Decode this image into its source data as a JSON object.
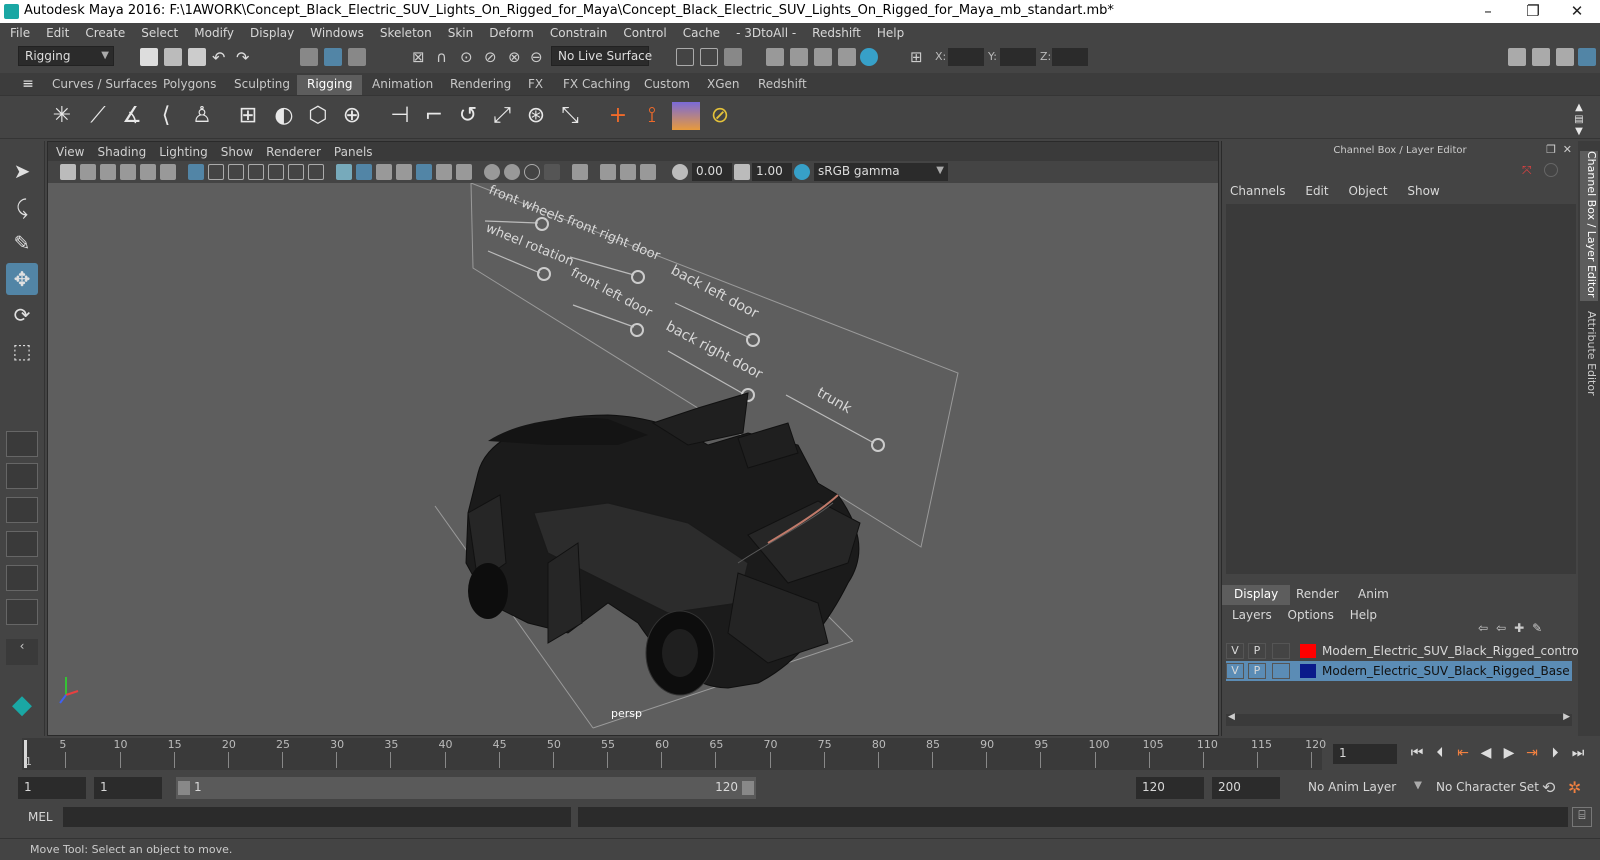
{
  "window": {
    "title": "Autodesk Maya 2016: F:\\1AWORK\\Concept_Black_Electric_SUV_Lights_On_Rigged_for_Maya\\Concept_Black_Electric_SUV_Lights_On_Rigged_for_Maya_mb_standart.mb*",
    "minimize": "–",
    "maximize": "❐",
    "close": "✕"
  },
  "menubar": [
    "File",
    "Edit",
    "Create",
    "Select",
    "Modify",
    "Display",
    "Windows",
    "Skeleton",
    "Skin",
    "Deform",
    "Constrain",
    "Control",
    "Cache",
    "- 3DtoAll -",
    "Redshift",
    "Help"
  ],
  "statusline": {
    "menuset": "Rigging",
    "live_surface": "No Live Surface",
    "x_label": "X:",
    "y_label": "Y:",
    "z_label": "Z:"
  },
  "shelf_tabs": [
    "Curves / Surfaces",
    "Polygons",
    "Sculpting",
    "Rigging",
    "Animation",
    "Rendering",
    "FX",
    "FX Caching",
    "Custom",
    "XGen",
    "Redshift"
  ],
  "viewport": {
    "menu": [
      "View",
      "Shading",
      "Lighting",
      "Show",
      "Renderer",
      "Panels"
    ],
    "exposure": "0.00",
    "gamma": "1.00",
    "color_space": "sRGB gamma",
    "camera_label": "persp",
    "controller_labels": [
      "front wheels",
      "wheel rotation",
      "front right door",
      "front left door",
      "back left door",
      "back right door",
      "trunk"
    ]
  },
  "channel_box": {
    "title": "Channel Box / Layer Editor",
    "menu": [
      "Channels",
      "Edit",
      "Object",
      "Show"
    ]
  },
  "layer_editor": {
    "tabs": [
      "Display",
      "Render",
      "Anim"
    ],
    "menu": [
      "Layers",
      "Options",
      "Help"
    ],
    "layers": [
      {
        "v": "V",
        "p": "P",
        "name": "Modern_Electric_SUV_Black_Rigged_controllers",
        "color": "#ff0000",
        "selected": false
      },
      {
        "v": "V",
        "p": "P",
        "name": "Modern_Electric_SUV_Black_Rigged_Base",
        "color": "#0a1a8a",
        "selected": true
      }
    ]
  },
  "side_tabs": [
    "Channel Box / Layer Editor",
    "Attribute Editor"
  ],
  "timeline": {
    "ticks": [
      5,
      10,
      15,
      20,
      25,
      30,
      35,
      40,
      45,
      50,
      55,
      60,
      65,
      70,
      75,
      80,
      85,
      90,
      95,
      100,
      105,
      110,
      115,
      120
    ],
    "first_label": "1",
    "current_frame": "1"
  },
  "range": {
    "start": "1",
    "playback_start": "1",
    "slider_start": "1",
    "slider_end": "120",
    "playback_end": "120",
    "end": "200",
    "anim_layer": "No Anim Layer",
    "character_set": "No Character Set"
  },
  "command_line": {
    "label": "MEL"
  },
  "help_line": {
    "text": "Move Tool: Select an object to move."
  },
  "colors": {
    "accent": "#5285a6",
    "selected_layer": "#5b8cb5"
  }
}
